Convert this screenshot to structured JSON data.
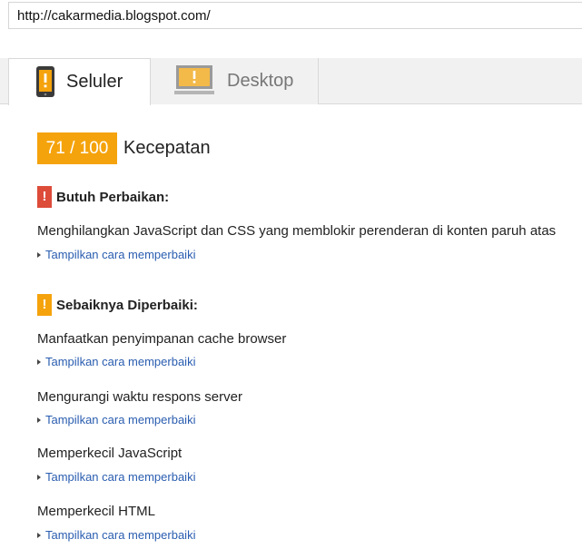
{
  "url": {
    "value": "http://cakarmedia.blogspot.com/"
  },
  "tabs": [
    {
      "label": "Seluler",
      "icon": "mobile-phone-icon",
      "active": true
    },
    {
      "label": "Desktop",
      "icon": "desktop-monitor-icon",
      "active": false
    }
  ],
  "score": {
    "value_text": "71 / 100",
    "value": 71,
    "max": 100,
    "label": "Kecepatan"
  },
  "sections": {
    "must_fix": {
      "badge": "!",
      "heading": "Butuh Perbaikan:",
      "rules": [
        {
          "title": "Menghilangkan JavaScript dan CSS yang memblokir perenderan di konten paruh atas",
          "link": "Tampilkan cara memperbaiki"
        }
      ]
    },
    "should_fix": {
      "badge": "!",
      "heading": "Sebaiknya Diperbaiki:",
      "rules": [
        {
          "title": "Manfaatkan penyimpanan cache browser",
          "link": "Tampilkan cara memperbaiki"
        },
        {
          "title": "Mengurangi waktu respons server",
          "link": "Tampilkan cara memperbaiki"
        },
        {
          "title": "Memperkecil JavaScript",
          "link": "Tampilkan cara memperbaiki"
        },
        {
          "title": "Memperkecil HTML",
          "link": "Tampilkan cara memperbaiki"
        }
      ]
    }
  },
  "colors": {
    "score_accent": "#f5a30c",
    "must_fix": "#dd4b39",
    "should_fix": "#f5a30c",
    "link": "#2a5db0"
  }
}
